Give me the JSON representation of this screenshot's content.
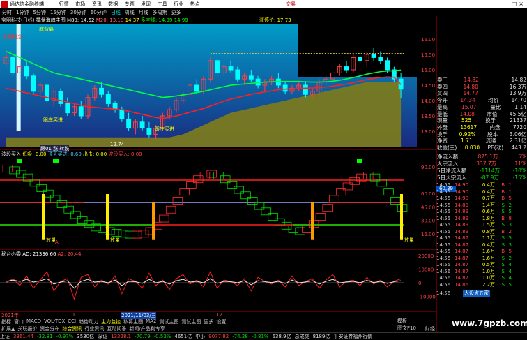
{
  "menubar": {
    "app": "通达信金融终端",
    "items": [
      "行情",
      "市场",
      "资讯",
      "数据",
      "专题",
      "发现",
      "工具",
      "行业",
      "热点"
    ],
    "trade": "交易",
    "window_ctrl": "□×"
  },
  "periods": [
    "分时",
    "1分钟",
    "5分钟",
    "15分钟",
    "30分钟",
    "60分钟",
    "日线",
    "周线",
    "月线",
    "多周期",
    "更多"
  ],
  "main_info": {
    "stock": "宝明科技(日线)",
    "indicator": "擒伏海魂主图",
    "m80": "M80: 14.52",
    "m20": "M20: 13.10",
    "v1": "14.37",
    "long_short": "多空线: 14.99",
    "v2": "14.99",
    "change_rate": "涨停价: 17.73"
  },
  "main_labels": {
    "top_left": "主题概念",
    "tag_a": "底背离",
    "tag_b": "跟庄买进",
    "tag_c": "跟庄买进",
    "price_low": "12.74",
    "bottom_tag": "跟01 涨 转跌"
  },
  "osc_info": {
    "name": "波段买入",
    "v1": "低吸: 0.00",
    "v2": "顶天买进: 0.60",
    "v3": "出击: 0.00",
    "v4": "波段买入: 0.00",
    "label_a": "放量",
    "label_b": "放量",
    "label_c": "放量",
    "label_d": "A"
  },
  "flow_info": {
    "name": "秘台必委",
    "ad": "AD: 21336.66",
    "a2": "A2: 20.44"
  },
  "dates": {
    "y": "2021年",
    "m1": "10",
    "m2": "11",
    "m3": "12",
    "cur": "2021/11/03/三"
  },
  "quote": {
    "rows": [
      [
        "卖三",
        "14.82",
        "",
        "14.82"
      ],
      [
        "卖四",
        "14.80",
        "",
        "16.3万"
      ],
      [
        "买四",
        "14.77",
        "",
        "13.9万"
      ],
      [
        "今开",
        "14.34",
        "均价",
        "14.70"
      ],
      [
        "最高",
        "15.07",
        "量比",
        "1.14"
      ],
      [
        "最低",
        "14.08",
        "市值",
        "45.5亿"
      ],
      [
        "现量",
        "525",
        "换手",
        "21337"
      ],
      [
        "外盘",
        "13617",
        "内盘",
        "7720"
      ],
      [
        "换手",
        "0.92%",
        "股本",
        "3.06亿"
      ],
      [
        "净资",
        "1.71",
        "流通",
        "2.31亿"
      ],
      [
        "收益(三)",
        "0.030",
        "PE(动)",
        "443.2"
      ]
    ],
    "colors": {
      "up": "#ff4040",
      "down": "#00e000",
      "neutral": "#e0e0e0",
      "name": "#e0e0e0"
    }
  },
  "flow_panel": {
    "rows": [
      [
        "净流入额",
        "875.1万",
        "5%"
      ],
      [
        "大宗流入",
        "337.7万",
        "11%"
      ],
      [
        "5日净流入额",
        "-1114万",
        "-10%"
      ],
      [
        "5日大宗流入",
        "-87.9万",
        "-15%"
      ]
    ],
    "badge": "60.39"
  },
  "ticks": [
    [
      "14:55",
      "14.90",
      "0.4万",
      "B",
      "1"
    ],
    [
      "14:55",
      "14.90",
      "0.4万",
      "B",
      "1"
    ],
    [
      "14:55",
      "14.90",
      "0.7万",
      "B",
      "5"
    ],
    [
      "14:55",
      "14.89",
      "1.4万",
      "S",
      "2"
    ],
    [
      "14:55",
      "14.89",
      "0.6万",
      "S",
      "5"
    ],
    [
      "14:55",
      "14.89",
      "1.8万",
      "B",
      "8"
    ],
    [
      "14:55",
      "14.89",
      "1.5万",
      "S",
      "3"
    ],
    [
      "14:55",
      "14.89",
      "0.8万",
      "B",
      "2"
    ],
    [
      "14:55",
      "14.87",
      "1.1万",
      "S",
      "5"
    ],
    [
      "14:55",
      "14.87",
      "0.4万",
      "S",
      "3"
    ],
    [
      "14:55",
      "14.87",
      "1.6万",
      "B",
      "5"
    ],
    [
      "14:55",
      "14.87",
      "1.6万",
      "S",
      "2"
    ],
    [
      "14:55",
      "14.87",
      "0.5万",
      "S",
      "4"
    ],
    [
      "14:56",
      "14.87",
      "1.0万",
      "S",
      "4"
    ],
    [
      "14:56",
      "14.87",
      "1.0万",
      "S",
      "4"
    ],
    [
      "14:56",
      "14.86",
      "2.2万",
      "S",
      "5"
    ]
  ],
  "tick_tail": {
    "label": "14:56",
    "badge": "人设点五密"
  },
  "bottom_tabs": [
    "指标",
    "窗口",
    "MACD",
    "VOL-TDX",
    "CCI",
    "趋势动力",
    "主力监控",
    "私募主图",
    "MA2",
    "测试主图",
    "测试主图",
    "更多",
    "设置"
  ],
  "bottom_tabs2": [
    "扩展▲",
    "关联报价",
    "资金分布",
    "综合资讯",
    "行业资讯",
    "互动问答",
    "新闻/产品利专享"
  ],
  "right_meta": [
    "模板",
    "图文F10",
    "财经"
  ],
  "status": [
    "上证",
    "3361.44",
    "-32.81",
    "-0.97%",
    "3530亿",
    "深证",
    "13328.1",
    "-70.79",
    "-0.53%",
    "4651亿",
    "中小",
    "9077.82",
    "-74.28",
    "-0.81%",
    "638.9亿",
    "总成交",
    "8189亿",
    "平安证券福州行情"
  ],
  "watermark": "www.7gpzb.com",
  "chart_data": [
    {
      "type": "candlestick",
      "name": "main",
      "ylim": [
        12.5,
        16.5
      ],
      "y_ticks": [
        "16.00",
        "15.50",
        "15.00",
        "14.50",
        "14.00",
        "13.50",
        "13.00"
      ],
      "candles": [
        [
          15.2,
          15.6,
          15.1,
          15.4
        ],
        [
          15.4,
          15.5,
          14.8,
          14.9
        ],
        [
          14.9,
          15.2,
          14.7,
          15.1
        ],
        [
          15.1,
          15.3,
          14.7,
          14.8
        ],
        [
          14.8,
          14.9,
          14.2,
          14.3
        ],
        [
          14.3,
          14.6,
          14.1,
          14.5
        ],
        [
          14.5,
          14.6,
          13.9,
          14.0
        ],
        [
          14.0,
          14.4,
          13.8,
          14.3
        ],
        [
          14.3,
          14.4,
          13.8,
          13.9
        ],
        [
          13.9,
          14.1,
          13.5,
          13.6
        ],
        [
          13.6,
          13.9,
          13.5,
          13.8
        ],
        [
          13.8,
          14.0,
          13.4,
          13.5
        ],
        [
          13.5,
          14.2,
          13.4,
          14.1
        ],
        [
          14.1,
          14.5,
          14.0,
          14.4
        ],
        [
          14.4,
          14.6,
          14.1,
          14.2
        ],
        [
          14.2,
          14.3,
          13.8,
          13.9
        ],
        [
          13.9,
          14.0,
          13.6,
          13.7
        ],
        [
          13.7,
          13.8,
          13.3,
          13.4
        ],
        [
          13.4,
          13.6,
          13.0,
          13.1
        ],
        [
          13.1,
          13.4,
          12.9,
          13.3
        ],
        [
          13.3,
          13.5,
          13.0,
          13.1
        ],
        [
          13.1,
          13.3,
          12.8,
          12.9
        ],
        [
          12.9,
          13.2,
          12.74,
          13.1
        ],
        [
          13.1,
          13.6,
          13.0,
          13.5
        ],
        [
          13.5,
          13.8,
          13.4,
          13.7
        ],
        [
          13.7,
          14.1,
          13.6,
          14.0
        ],
        [
          14.0,
          14.3,
          13.9,
          14.2
        ],
        [
          14.2,
          14.6,
          14.1,
          14.5
        ],
        [
          14.5,
          14.7,
          14.2,
          14.3
        ],
        [
          14.3,
          14.8,
          14.2,
          14.7
        ],
        [
          14.7,
          15.4,
          14.6,
          15.3
        ],
        [
          15.3,
          15.4,
          14.8,
          14.9
        ],
        [
          14.9,
          15.2,
          14.8,
          15.1
        ],
        [
          15.1,
          15.3,
          14.9,
          15.0
        ],
        [
          15.0,
          15.1,
          14.6,
          14.7
        ],
        [
          14.7,
          14.9,
          14.5,
          14.8
        ],
        [
          14.8,
          15.0,
          14.6,
          14.7
        ],
        [
          14.7,
          14.8,
          14.4,
          14.5
        ],
        [
          14.5,
          14.7,
          14.3,
          14.6
        ],
        [
          14.6,
          14.8,
          14.5,
          14.7
        ],
        [
          14.7,
          14.9,
          14.4,
          14.5
        ],
        [
          14.5,
          14.6,
          14.2,
          14.3
        ],
        [
          14.3,
          14.5,
          14.2,
          14.4
        ],
        [
          14.4,
          14.6,
          14.3,
          14.5
        ],
        [
          14.5,
          14.6,
          14.1,
          14.2
        ],
        [
          14.2,
          14.4,
          14.1,
          14.3
        ],
        [
          14.3,
          14.7,
          14.2,
          14.6
        ],
        [
          14.6,
          14.8,
          14.5,
          14.7
        ],
        [
          14.7,
          15.0,
          14.6,
          14.9
        ],
        [
          14.9,
          15.2,
          14.8,
          15.1
        ],
        [
          15.1,
          15.3,
          14.9,
          15.0
        ],
        [
          15.0,
          15.5,
          14.9,
          15.4
        ],
        [
          15.4,
          15.6,
          15.2,
          15.3
        ],
        [
          15.3,
          15.6,
          15.1,
          15.5
        ],
        [
          15.5,
          15.7,
          15.3,
          15.4
        ],
        [
          15.4,
          15.6,
          15.2,
          15.3
        ],
        [
          15.3,
          15.4,
          14.9,
          15.0
        ],
        [
          15.0,
          15.1,
          14.6,
          14.7
        ],
        [
          14.7,
          14.9,
          14.08,
          14.37
        ]
      ],
      "ma_green": [
        15.6,
        15.5,
        15.4,
        15.3,
        15.2,
        15.1,
        15.0,
        14.9,
        14.85,
        14.8,
        14.75,
        14.7,
        14.65,
        14.6,
        14.55,
        14.5,
        14.45,
        14.4,
        14.35,
        14.3,
        14.25,
        14.2,
        14.15,
        14.1,
        14.12,
        14.15,
        14.18,
        14.22,
        14.26,
        14.3,
        14.35,
        14.4,
        14.45,
        14.5,
        14.52,
        14.54,
        14.56,
        14.58,
        14.6,
        14.61,
        14.62,
        14.62,
        14.62,
        14.62,
        14.61,
        14.6,
        14.6,
        14.61,
        14.63,
        14.66,
        14.7,
        14.75,
        14.8,
        14.86,
        14.9,
        14.94,
        14.96,
        14.97,
        14.99
      ],
      "ma_red": [
        14.4,
        14.35,
        14.3,
        14.25,
        14.2,
        14.15,
        14.1,
        14.05,
        14.0,
        13.95,
        13.9,
        13.85,
        13.8,
        13.78,
        13.76,
        13.74,
        13.72,
        13.7,
        13.65,
        13.6,
        13.55,
        13.5,
        13.45,
        13.42,
        13.45,
        13.5,
        13.56,
        13.62,
        13.68,
        13.74,
        13.82,
        13.9,
        13.98,
        14.05,
        14.1,
        14.15,
        14.2,
        14.24,
        14.28,
        14.32,
        14.35,
        14.37,
        14.38,
        14.4,
        14.4,
        14.41,
        14.42,
        14.44,
        14.47,
        14.5,
        14.54,
        14.58,
        14.63,
        14.68,
        14.72,
        14.75,
        14.77,
        14.76,
        14.52
      ],
      "olive_base": [
        12.8,
        12.8,
        12.8,
        12.8,
        12.8,
        12.8,
        12.8,
        12.8,
        12.8,
        12.8,
        12.8,
        12.8,
        12.8,
        12.8,
        12.8,
        12.8,
        12.8,
        12.8,
        12.8,
        12.8,
        12.8,
        12.8,
        12.8,
        12.8,
        12.8,
        12.85,
        12.9,
        13.0,
        13.1,
        13.2,
        13.3,
        13.4,
        13.5,
        13.6,
        13.65,
        13.7,
        13.75,
        13.8,
        13.85,
        13.9,
        13.95,
        14.0,
        14.05,
        14.1,
        14.15,
        14.2,
        14.25,
        14.3,
        14.35,
        14.4,
        14.45,
        14.5,
        14.55,
        14.6,
        14.6,
        14.6,
        14.6,
        14.6,
        14.6
      ],
      "resistance": 15.53,
      "spike": {
        "index": 22,
        "high": 19.0,
        "low": 13.0
      }
    },
    {
      "type": "step",
      "name": "osc",
      "ylim": [
        0,
        100
      ],
      "y_ticks": [
        "90.00",
        "60.00",
        "45.00",
        "30.00",
        "15.00"
      ],
      "levels": [
        75,
        50,
        25
      ],
      "series": [
        88,
        86,
        82,
        78,
        72,
        66,
        60,
        54,
        48,
        42,
        36,
        30,
        26,
        22,
        20,
        18,
        16,
        15,
        14,
        14,
        15,
        18,
        24,
        32,
        42,
        52,
        62,
        70,
        76,
        80,
        82,
        80,
        76,
        70,
        64,
        58,
        52,
        46,
        40,
        34,
        28,
        24,
        20,
        18,
        20,
        26,
        34,
        44,
        54,
        62,
        68,
        74,
        78,
        80,
        78,
        72,
        62,
        52,
        44
      ]
    },
    {
      "type": "line",
      "name": "flow",
      "ylim": [
        -20000,
        20000
      ],
      "y_ticks": [
        "20000",
        "10000",
        "0",
        "-10000"
      ],
      "a": [
        0,
        3000,
        -2000,
        5000,
        -4000,
        2000,
        8000,
        -6000,
        1000,
        3000,
        -12000,
        4000,
        6000,
        -3000,
        2000,
        -1000,
        5000,
        -8000,
        3000,
        1000,
        -4000,
        7000,
        -2000,
        2000,
        -5000,
        3000,
        6000,
        -1000,
        2000,
        -3000,
        8000,
        -4000,
        2000,
        1000,
        -2000,
        3000,
        -6000,
        4000,
        1000,
        -1000,
        2000,
        -3000,
        5000,
        -2000,
        1000,
        3000,
        -4000,
        2000,
        6000,
        -3000,
        1000,
        2000,
        -2000,
        4000,
        -1000,
        2000,
        -3000,
        1000,
        3000
      ],
      "b": [
        1000,
        2000,
        1000,
        2500,
        500,
        1500,
        3000,
        -1000,
        500,
        1500,
        -4000,
        1000,
        2500,
        500,
        1000,
        0,
        2000,
        -2000,
        1000,
        800,
        -500,
        2500,
        0,
        1000,
        -1000,
        1500,
        2500,
        500,
        1000,
        0,
        3000,
        -500,
        1000,
        800,
        0,
        1500,
        -1500,
        1500,
        800,
        200,
        1000,
        -500,
        2000,
        0,
        600,
        1500,
        -1000,
        1000,
        2500,
        0,
        600,
        1000,
        0,
        1800,
        200,
        1000,
        -500,
        800,
        1500
      ]
    }
  ]
}
